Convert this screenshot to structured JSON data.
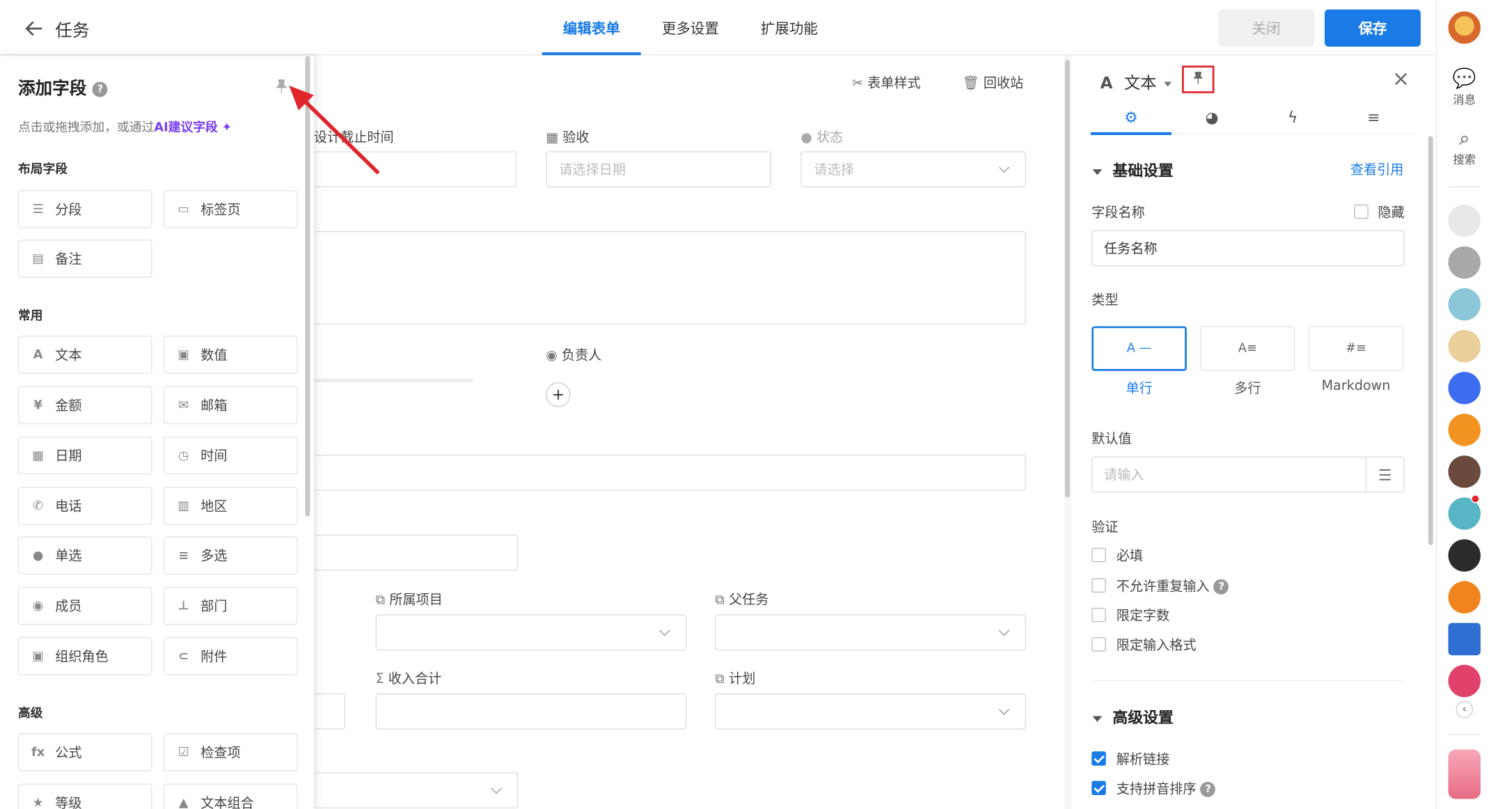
{
  "header": {
    "title": "任务",
    "tabs": [
      {
        "label": "编辑表单",
        "active": true
      },
      {
        "label": "更多设置",
        "active": false
      },
      {
        "label": "扩展功能",
        "active": false
      }
    ],
    "close_label": "关闭",
    "save_label": "保存",
    "accent_color": "#1a7be6"
  },
  "left_panel": {
    "title": "添加字段",
    "hint_prefix": "点击或拖拽添加，或通过",
    "hint_ai": "AI建议字段",
    "sections": [
      {
        "title": "布局字段",
        "fields": [
          {
            "label": "分段",
            "icon": "section-icon"
          },
          {
            "label": "标签页",
            "icon": "tab-page-icon"
          },
          {
            "label": "备注",
            "icon": "note-icon"
          }
        ]
      },
      {
        "title": "常用",
        "fields": [
          {
            "label": "文本",
            "icon": "text-icon"
          },
          {
            "label": "数值",
            "icon": "number-icon"
          },
          {
            "label": "金额",
            "icon": "currency-icon"
          },
          {
            "label": "邮箱",
            "icon": "mail-icon"
          },
          {
            "label": "日期",
            "icon": "calendar-icon"
          },
          {
            "label": "时间",
            "icon": "clock-icon"
          },
          {
            "label": "电话",
            "icon": "phone-icon"
          },
          {
            "label": "地区",
            "icon": "map-icon"
          },
          {
            "label": "单选",
            "icon": "single-select-icon"
          },
          {
            "label": "多选",
            "icon": "multi-select-icon"
          },
          {
            "label": "成员",
            "icon": "member-icon"
          },
          {
            "label": "部门",
            "icon": "department-icon"
          },
          {
            "label": "组织角色",
            "icon": "org-role-icon"
          },
          {
            "label": "附件",
            "icon": "attachment-icon"
          }
        ]
      },
      {
        "title": "高级",
        "fields": [
          {
            "label": "公式",
            "icon": "formula-icon"
          },
          {
            "label": "检查项",
            "icon": "checkbox-icon"
          },
          {
            "label": "等级",
            "icon": "star-icon"
          },
          {
            "label": "文本组合",
            "icon": "text-combo-icon"
          }
        ]
      }
    ]
  },
  "form": {
    "toolbar": {
      "style_label": "表单样式",
      "recycle_label": "回收站"
    },
    "fields": {
      "design_deadline": "设计截止时间",
      "acceptance": "验收",
      "acceptance_placeholder": "请选择日期",
      "status": "状态",
      "status_placeholder": "请选择",
      "owner": "负责人",
      "project": "所属项目",
      "parent_task": "父任务",
      "income_total": "收入合计",
      "plan": "计划"
    }
  },
  "right_panel": {
    "field_type_title": "文本",
    "basic_section": "基础设置",
    "view_refs": "查看引用",
    "field_name_label": "字段名称",
    "hidden_label": "隐藏",
    "field_name_value": "任务名称",
    "type_label": "类型",
    "types": [
      {
        "label": "单行",
        "selected": true
      },
      {
        "label": "多行",
        "selected": false
      },
      {
        "label": "Markdown",
        "selected": false
      }
    ],
    "default_label": "默认值",
    "default_placeholder": "请输入",
    "validation_label": "验证",
    "validations": [
      {
        "label": "必填",
        "checked": false
      },
      {
        "label": "不允许重复输入",
        "checked": false
      },
      {
        "label": "限定字数",
        "checked": false
      },
      {
        "label": "限定输入格式",
        "checked": false
      }
    ],
    "advanced_section": "高级设置",
    "advanced": [
      {
        "label": "解析链接",
        "checked": true
      },
      {
        "label": "支持拼音排序",
        "checked": true
      }
    ]
  },
  "sidebar": {
    "messages_label": "消息",
    "search_label": "搜索"
  }
}
